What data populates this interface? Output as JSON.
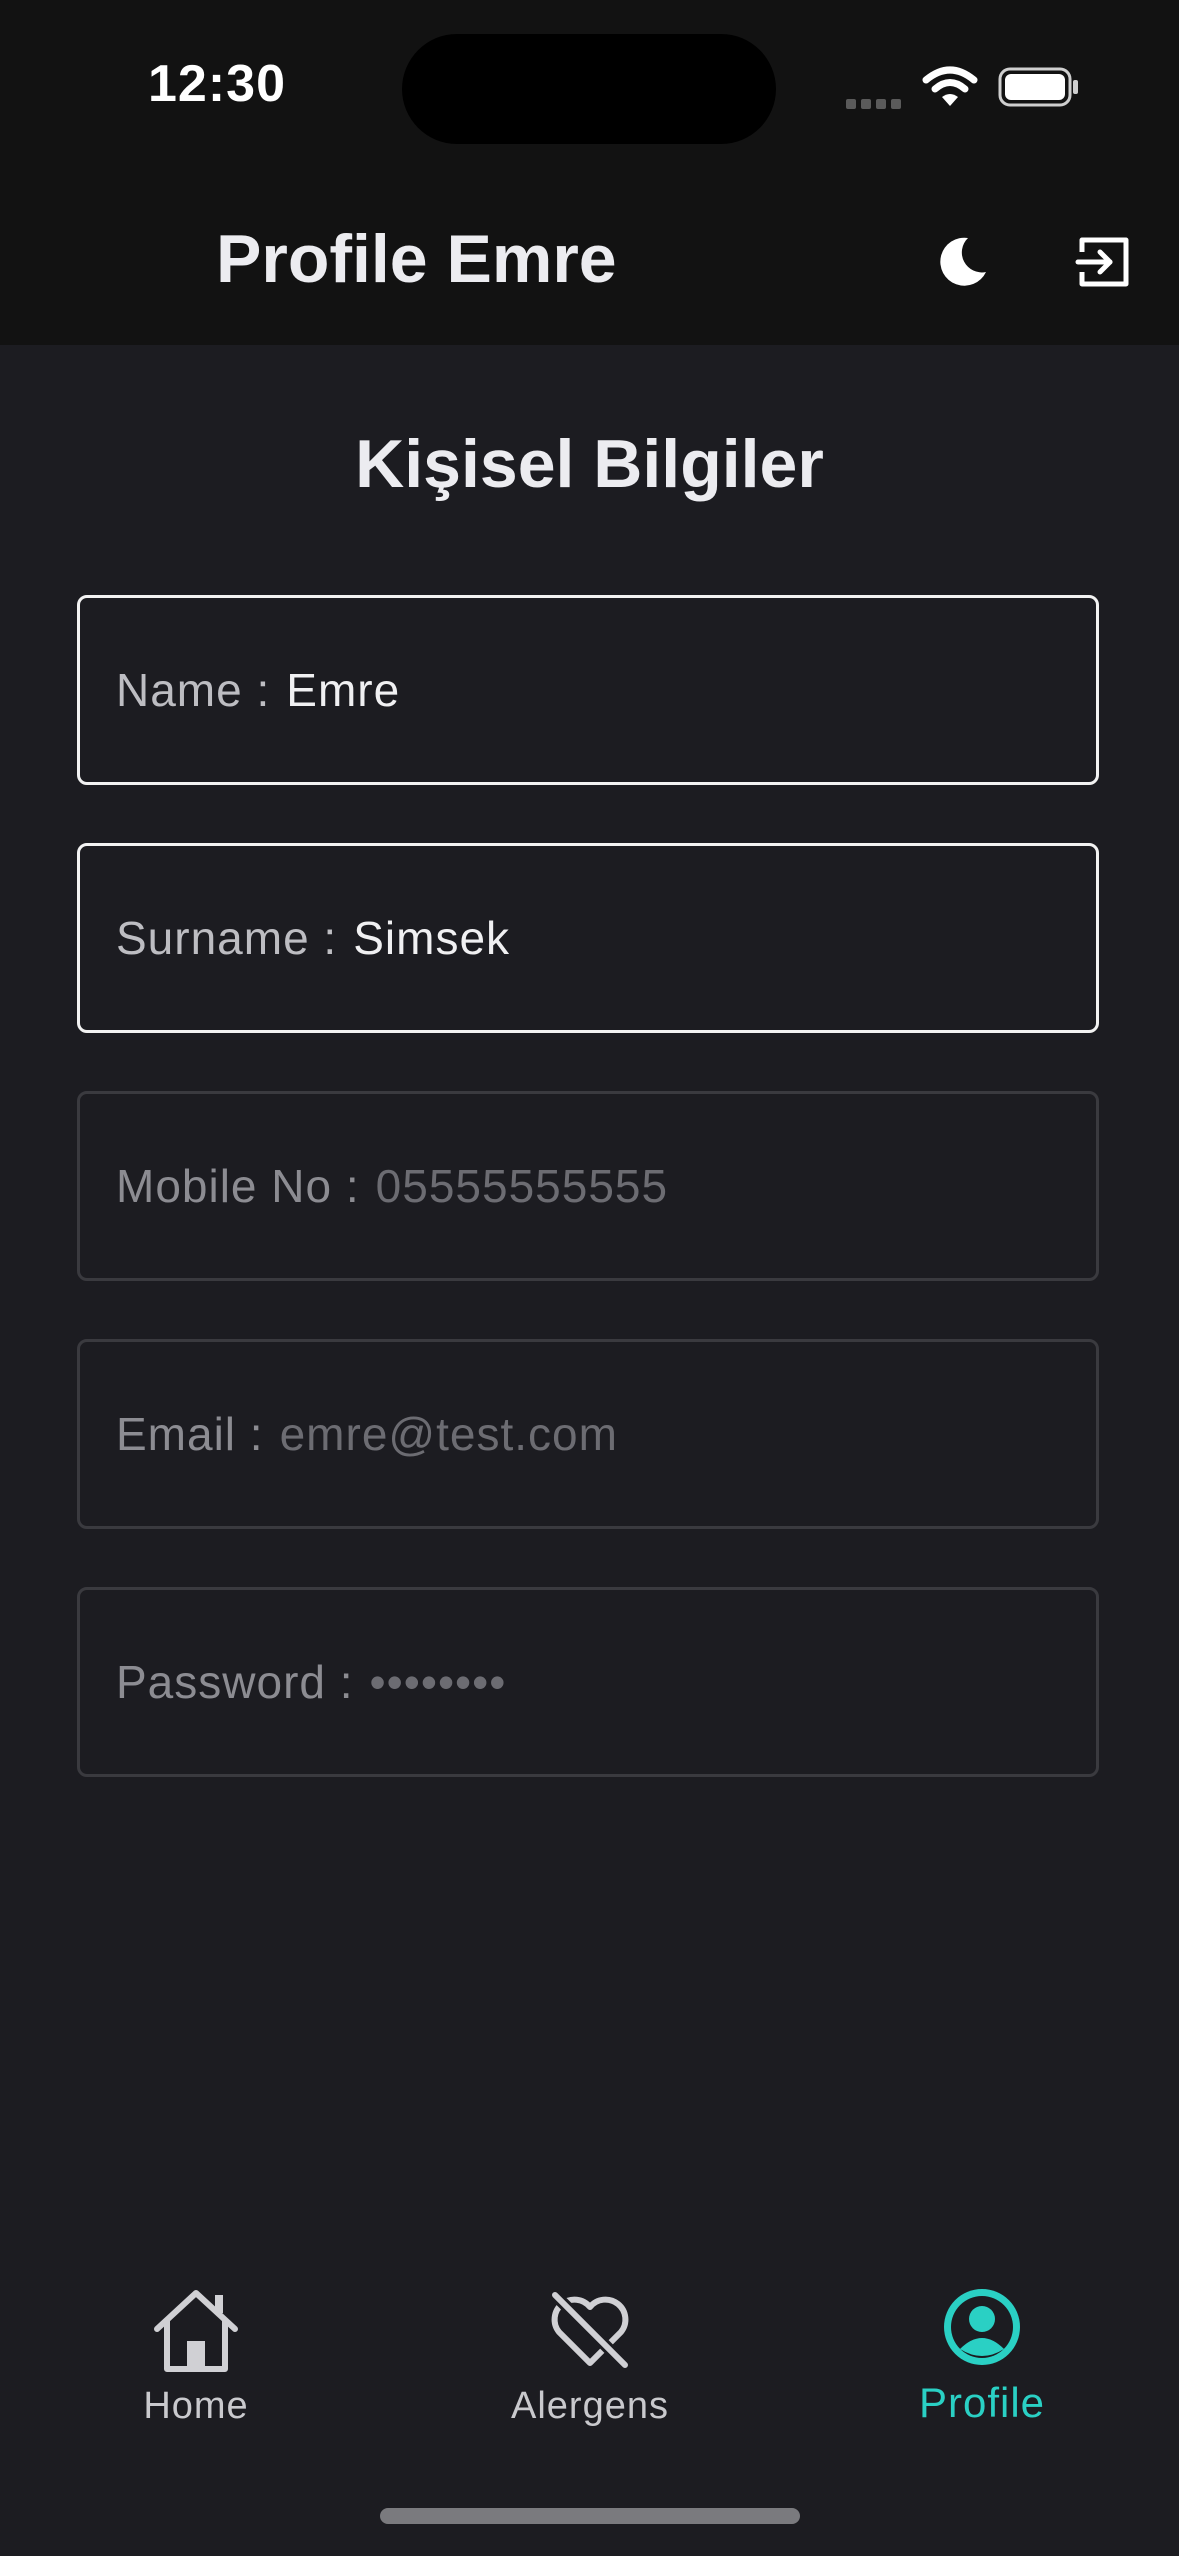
{
  "status_bar": {
    "time": "12:30",
    "icons": [
      "signal-icon",
      "wifi-icon",
      "battery-icon"
    ]
  },
  "header": {
    "title": "Profile Emre",
    "theme_icon": "moon-icon",
    "logout_icon": "logout-icon"
  },
  "section": {
    "title": "Kişisel Bilgiler"
  },
  "form": {
    "fields": [
      {
        "label": "Name :",
        "value": "Emre",
        "state": "editable"
      },
      {
        "label": "Surname :",
        "value": "Simsek",
        "state": "editable"
      },
      {
        "label": "Mobile No :",
        "value": "05555555555",
        "state": "disabled"
      },
      {
        "label": "Email :",
        "value": "emre@test.com",
        "state": "disabled"
      },
      {
        "label": "Password :",
        "value": "••••••••",
        "state": "disabled"
      }
    ]
  },
  "tabs": [
    {
      "label": "Home",
      "icon": "home-icon",
      "active": false
    },
    {
      "label": "Alergens",
      "icon": "heart-crossed-icon",
      "active": false
    },
    {
      "label": "Profile",
      "icon": "user-circle-icon",
      "active": true
    }
  ],
  "colors": {
    "background": "#1c1c21",
    "header": "#121212",
    "accent": "#2ad0c4"
  }
}
